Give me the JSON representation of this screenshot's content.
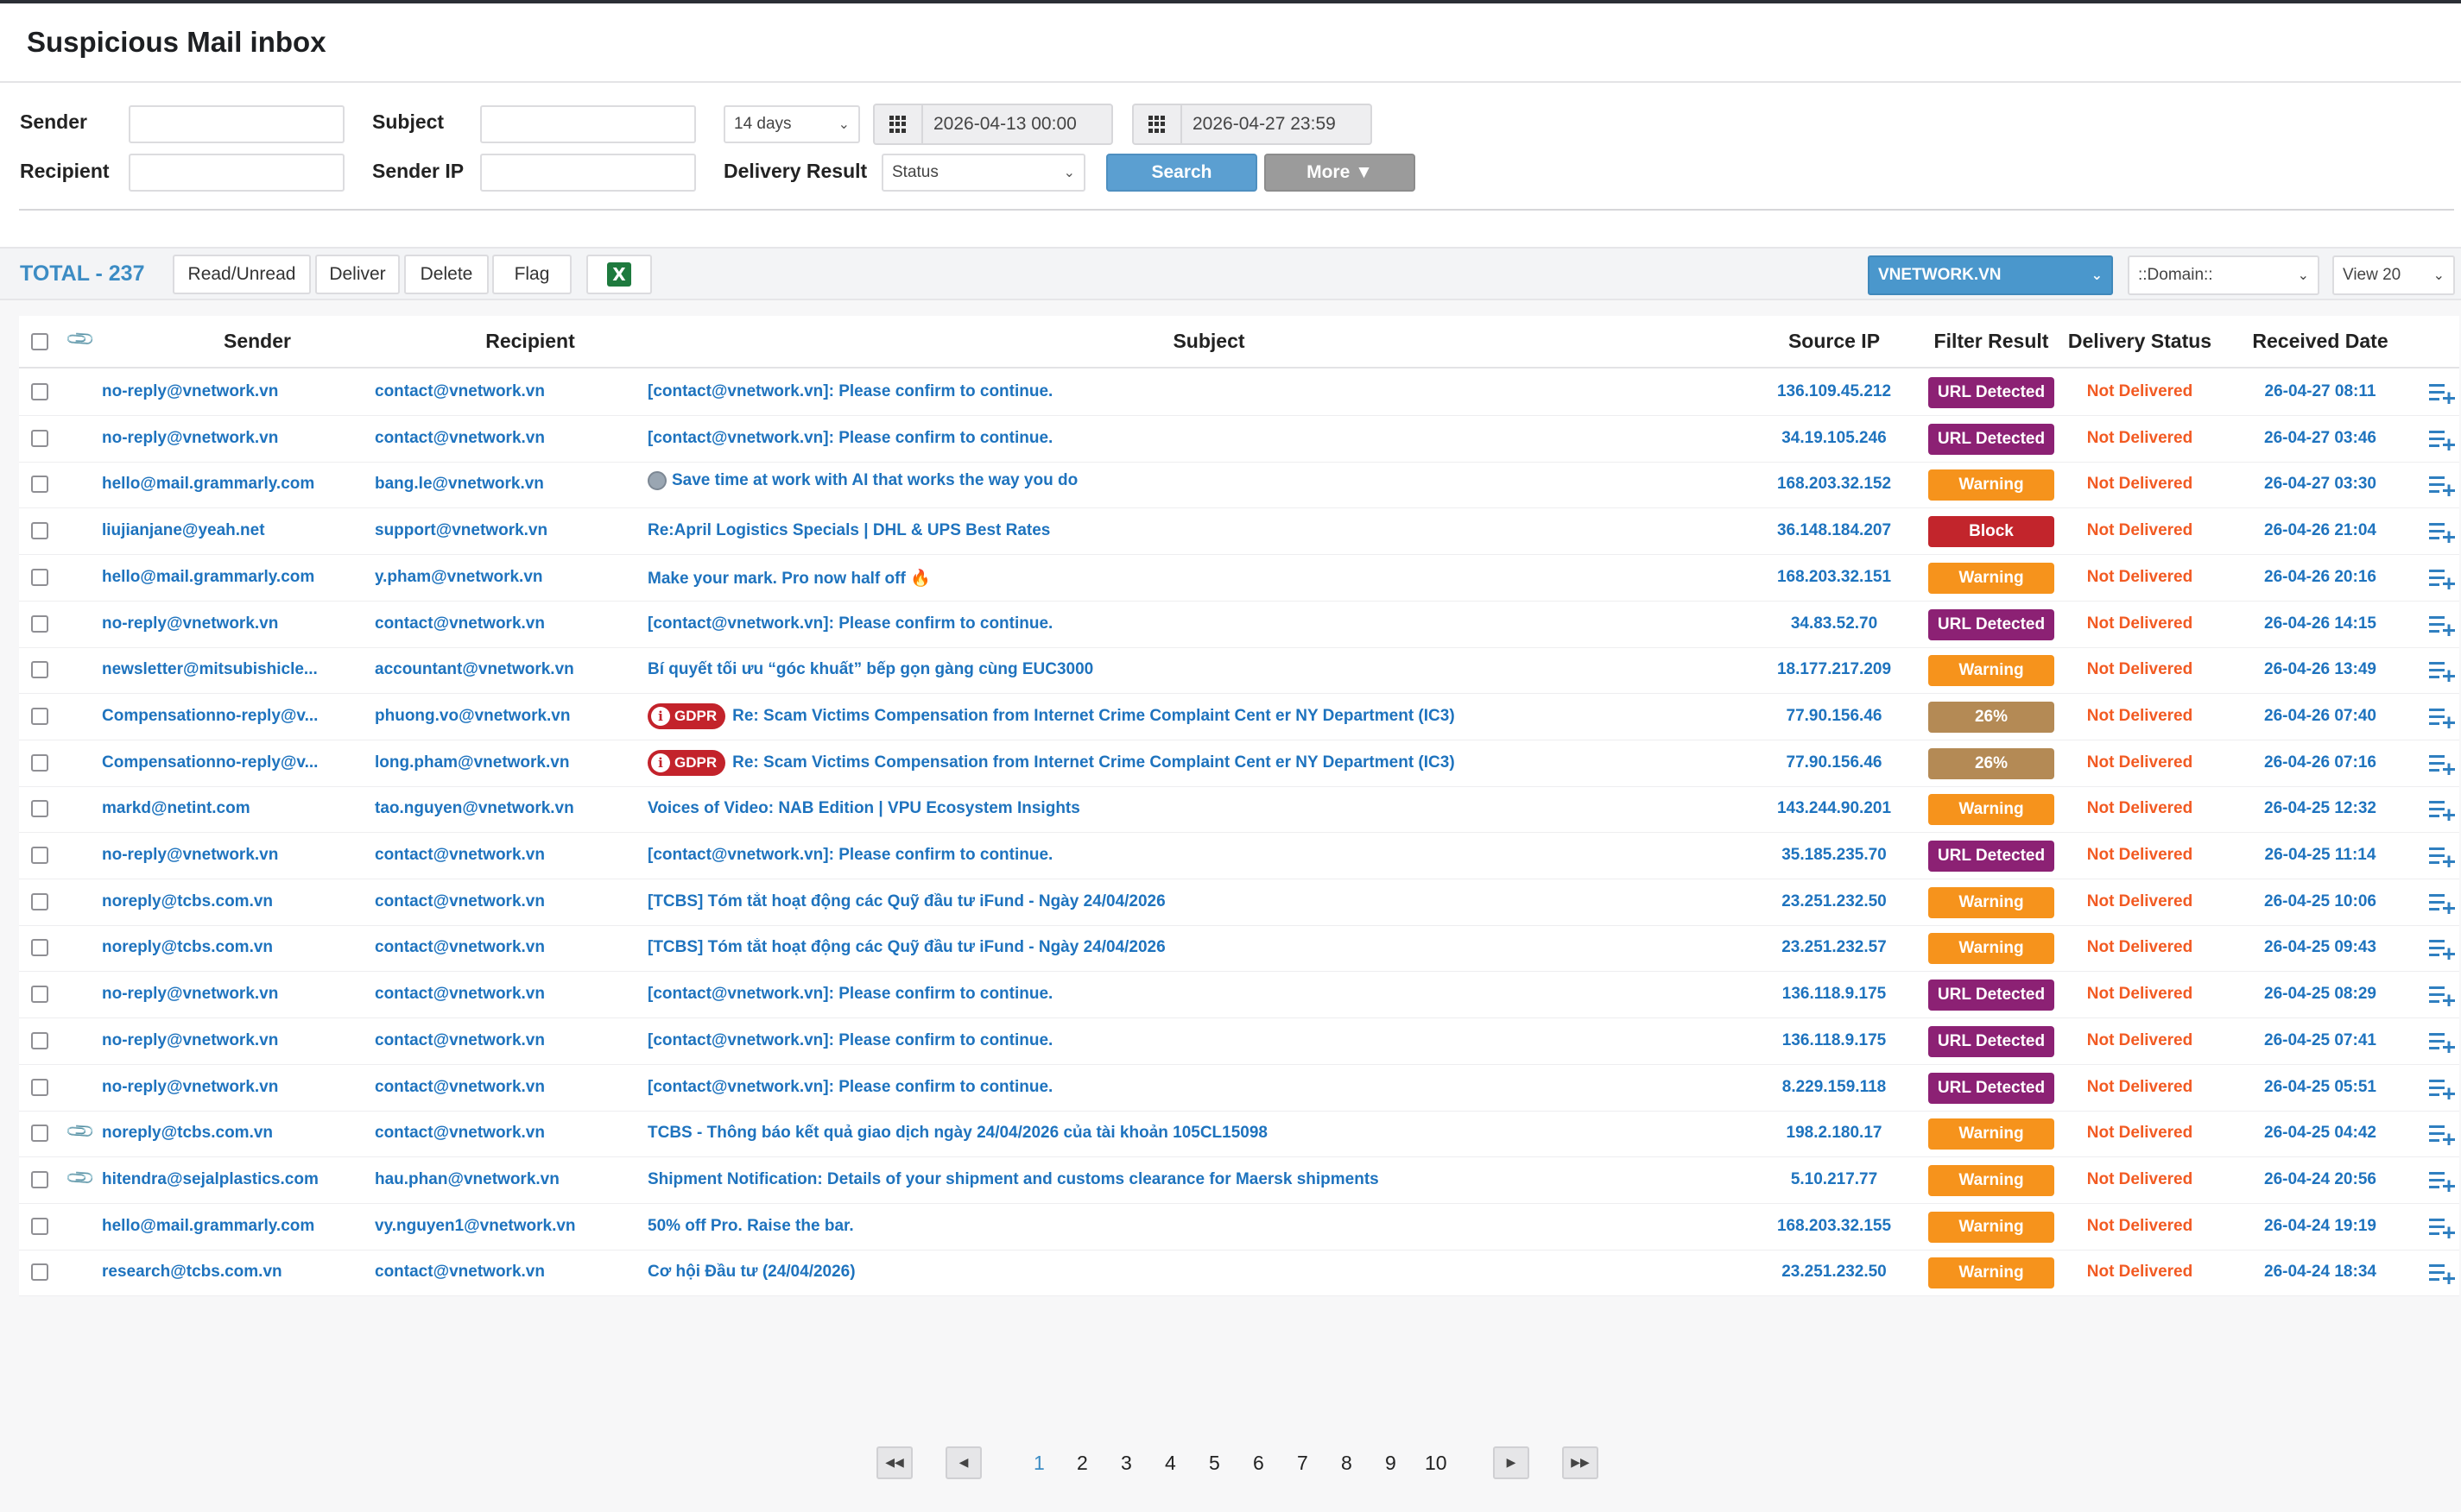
{
  "header": {
    "title": "Suspicious Mail inbox"
  },
  "filters": {
    "sender_label": "Sender",
    "recipient_label": "Recipient",
    "subject_label": "Subject",
    "sender_ip_label": "Sender IP",
    "delivery_result_label": "Delivery Result",
    "range_value": "14 days",
    "status_value": "Status",
    "date_from": "2026-04-13 00:00",
    "date_to": "2026-04-27 23:59",
    "search_label": "Search",
    "more_label": "More ▼"
  },
  "toolbar": {
    "total": "TOTAL - 237",
    "read_unread": "Read/Unread",
    "deliver": "Deliver",
    "delete": "Delete",
    "flag": "Flag",
    "excel_icon": "excel-export-icon",
    "org_value": "VNETWORK.VN",
    "domain_value": "::Domain::",
    "view_value": "View 20"
  },
  "table": {
    "headers": {
      "sender": "Sender",
      "recipient": "Recipient",
      "subject": "Subject",
      "source_ip": "Source IP",
      "filter_result": "Filter Result",
      "delivery_status": "Delivery Status",
      "received_date": "Received Date"
    },
    "rows": [
      {
        "sender": "no-reply@vnetwork.vn",
        "recipient": "contact@vnetwork.vn",
        "subject": "[contact@vnetwork.vn]: Please confirm to continue.",
        "ip": "136.109.45.212",
        "filter": "URL Detected",
        "filter_type": "url",
        "status": "Not Delivered",
        "date": "26-04-27 08:11",
        "attach": false,
        "gdpr": false,
        "globe": false
      },
      {
        "sender": "no-reply@vnetwork.vn",
        "recipient": "contact@vnetwork.vn",
        "subject": "[contact@vnetwork.vn]: Please confirm to continue.",
        "ip": "34.19.105.246",
        "filter": "URL Detected",
        "filter_type": "url",
        "status": "Not Delivered",
        "date": "26-04-27 03:46",
        "attach": false,
        "gdpr": false,
        "globe": false
      },
      {
        "sender": "hello@mail.grammarly.com",
        "recipient": "bang.le@vnetwork.vn",
        "subject": "Save time at work with AI that works the way you do",
        "ip": "168.203.32.152",
        "filter": "Warning",
        "filter_type": "warn",
        "status": "Not Delivered",
        "date": "26-04-27 03:30",
        "attach": false,
        "gdpr": false,
        "globe": true
      },
      {
        "sender": "liujianjane@yeah.net",
        "recipient": "support@vnetwork.vn",
        "subject": "Re:April Logistics Specials | DHL & UPS Best Rates",
        "ip": "36.148.184.207",
        "filter": "Block",
        "filter_type": "block",
        "status": "Not Delivered",
        "date": "26-04-26 21:04",
        "attach": false,
        "gdpr": false,
        "globe": false
      },
      {
        "sender": "hello@mail.grammarly.com",
        "recipient": "y.pham@vnetwork.vn",
        "subject": "Make your mark. Pro now half off 🔥",
        "ip": "168.203.32.151",
        "filter": "Warning",
        "filter_type": "warn",
        "status": "Not Delivered",
        "date": "26-04-26 20:16",
        "attach": false,
        "gdpr": false,
        "globe": false
      },
      {
        "sender": "no-reply@vnetwork.vn",
        "recipient": "contact@vnetwork.vn",
        "subject": "[contact@vnetwork.vn]: Please confirm to continue.",
        "ip": "34.83.52.70",
        "filter": "URL Detected",
        "filter_type": "url",
        "status": "Not Delivered",
        "date": "26-04-26 14:15",
        "attach": false,
        "gdpr": false,
        "globe": false
      },
      {
        "sender": "newsletter@mitsubishicle...",
        "recipient": "accountant@vnetwork.vn",
        "subject": "Bí quyết tối ưu “góc khuất” bếp gọn gàng cùng EUC3000",
        "ip": "18.177.217.209",
        "filter": "Warning",
        "filter_type": "warn",
        "status": "Not Delivered",
        "date": "26-04-26 13:49",
        "attach": false,
        "gdpr": false,
        "globe": false
      },
      {
        "sender": "Compensationno-reply@v...",
        "recipient": "phuong.vo@vnetwork.vn",
        "subject": "Re: Scam Victims Compensation from Internet Crime Complaint Cent er NY Department (IC3)",
        "ip": "77.90.156.46",
        "filter": "26%",
        "filter_type": "pct",
        "status": "Not Delivered",
        "date": "26-04-26 07:40",
        "attach": false,
        "gdpr": true,
        "globe": false
      },
      {
        "sender": "Compensationno-reply@v...",
        "recipient": "long.pham@vnetwork.vn",
        "subject": "Re: Scam Victims Compensation from Internet Crime Complaint Cent er NY Department (IC3)",
        "ip": "77.90.156.46",
        "filter": "26%",
        "filter_type": "pct",
        "status": "Not Delivered",
        "date": "26-04-26 07:16",
        "attach": false,
        "gdpr": true,
        "globe": false
      },
      {
        "sender": "markd@netint.com",
        "recipient": "tao.nguyen@vnetwork.vn",
        "subject": "Voices of Video: NAB Edition | VPU Ecosystem Insights",
        "ip": "143.244.90.201",
        "filter": "Warning",
        "filter_type": "warn",
        "status": "Not Delivered",
        "date": "26-04-25 12:32",
        "attach": false,
        "gdpr": false,
        "globe": false
      },
      {
        "sender": "no-reply@vnetwork.vn",
        "recipient": "contact@vnetwork.vn",
        "subject": "[contact@vnetwork.vn]: Please confirm to continue.",
        "ip": "35.185.235.70",
        "filter": "URL Detected",
        "filter_type": "url",
        "status": "Not Delivered",
        "date": "26-04-25 11:14",
        "attach": false,
        "gdpr": false,
        "globe": false
      },
      {
        "sender": "noreply@tcbs.com.vn",
        "recipient": "contact@vnetwork.vn",
        "subject": "[TCBS] Tóm tắt hoạt động các Quỹ đầu tư iFund - Ngày 24/04/2026",
        "ip": "23.251.232.50",
        "filter": "Warning",
        "filter_type": "warn",
        "status": "Not Delivered",
        "date": "26-04-25 10:06",
        "attach": false,
        "gdpr": false,
        "globe": false
      },
      {
        "sender": "noreply@tcbs.com.vn",
        "recipient": "contact@vnetwork.vn",
        "subject": "[TCBS] Tóm tắt hoạt động các Quỹ đầu tư iFund - Ngày 24/04/2026",
        "ip": "23.251.232.57",
        "filter": "Warning",
        "filter_type": "warn",
        "status": "Not Delivered",
        "date": "26-04-25 09:43",
        "attach": false,
        "gdpr": false,
        "globe": false
      },
      {
        "sender": "no-reply@vnetwork.vn",
        "recipient": "contact@vnetwork.vn",
        "subject": "[contact@vnetwork.vn]: Please confirm to continue.",
        "ip": "136.118.9.175",
        "filter": "URL Detected",
        "filter_type": "url",
        "status": "Not Delivered",
        "date": "26-04-25 08:29",
        "attach": false,
        "gdpr": false,
        "globe": false
      },
      {
        "sender": "no-reply@vnetwork.vn",
        "recipient": "contact@vnetwork.vn",
        "subject": "[contact@vnetwork.vn]: Please confirm to continue.",
        "ip": "136.118.9.175",
        "filter": "URL Detected",
        "filter_type": "url",
        "status": "Not Delivered",
        "date": "26-04-25 07:41",
        "attach": false,
        "gdpr": false,
        "globe": false
      },
      {
        "sender": "no-reply@vnetwork.vn",
        "recipient": "contact@vnetwork.vn",
        "subject": "[contact@vnetwork.vn]: Please confirm to continue.",
        "ip": "8.229.159.118",
        "filter": "URL Detected",
        "filter_type": "url",
        "status": "Not Delivered",
        "date": "26-04-25 05:51",
        "attach": false,
        "gdpr": false,
        "globe": false
      },
      {
        "sender": "noreply@tcbs.com.vn",
        "recipient": "contact@vnetwork.vn",
        "subject": "TCBS - Thông báo kết quả giao dịch ngày 24/04/2026 của tài khoản 105CL15098",
        "ip": "198.2.180.17",
        "filter": "Warning",
        "filter_type": "warn",
        "status": "Not Delivered",
        "date": "26-04-25 04:42",
        "attach": true,
        "gdpr": false,
        "globe": false
      },
      {
        "sender": "hitendra@sejalplastics.com",
        "recipient": "hau.phan@vnetwork.vn",
        "subject": "Shipment Notification: Details of your shipment and customs clearance for Maersk shipments",
        "ip": "5.10.217.77",
        "filter": "Warning",
        "filter_type": "warn",
        "status": "Not Delivered",
        "date": "26-04-24 20:56",
        "attach": true,
        "gdpr": false,
        "globe": false
      },
      {
        "sender": "hello@mail.grammarly.com",
        "recipient": "vy.nguyen1@vnetwork.vn",
        "subject": "50% off Pro. Raise the bar.",
        "ip": "168.203.32.155",
        "filter": "Warning",
        "filter_type": "warn",
        "status": "Not Delivered",
        "date": "26-04-24 19:19",
        "attach": false,
        "gdpr": false,
        "globe": false
      },
      {
        "sender": "research@tcbs.com.vn",
        "recipient": "contact@vnetwork.vn",
        "subject": "Cơ hội Đầu tư (24/04/2026)",
        "ip": "23.251.232.50",
        "filter": "Warning",
        "filter_type": "warn",
        "status": "Not Delivered",
        "date": "26-04-24 18:34",
        "attach": false,
        "gdpr": false,
        "globe": false
      }
    ]
  },
  "gdpr_label": "GDPR",
  "pagination": {
    "pages": [
      "1",
      "2",
      "3",
      "4",
      "5",
      "6",
      "7",
      "8",
      "9",
      "10"
    ],
    "current": "1"
  }
}
